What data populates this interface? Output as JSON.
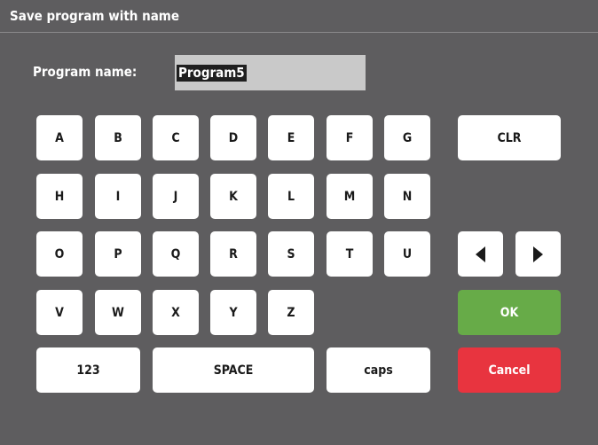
{
  "dialog": {
    "title": "Save program with name"
  },
  "name_field": {
    "label": "Program name:",
    "value": "Program5"
  },
  "keys": {
    "row1": [
      "A",
      "B",
      "C",
      "D",
      "E",
      "F",
      "G"
    ],
    "row2": [
      "H",
      "I",
      "J",
      "K",
      "L",
      "M",
      "N"
    ],
    "row3": [
      "O",
      "P",
      "Q",
      "R",
      "S",
      "T",
      "U"
    ],
    "row4": [
      "V",
      "W",
      "X",
      "Y",
      "Z"
    ]
  },
  "controls": {
    "clr": "CLR",
    "num": "123",
    "space": "SPACE",
    "caps": "caps",
    "ok": "OK",
    "cancel": "Cancel",
    "left_icon": "triangle-left",
    "right_icon": "triangle-right"
  },
  "colors": {
    "background": "#5e5d5f",
    "ok": "#67ab48",
    "cancel": "#e8343f",
    "field": "#c9c9c9"
  }
}
